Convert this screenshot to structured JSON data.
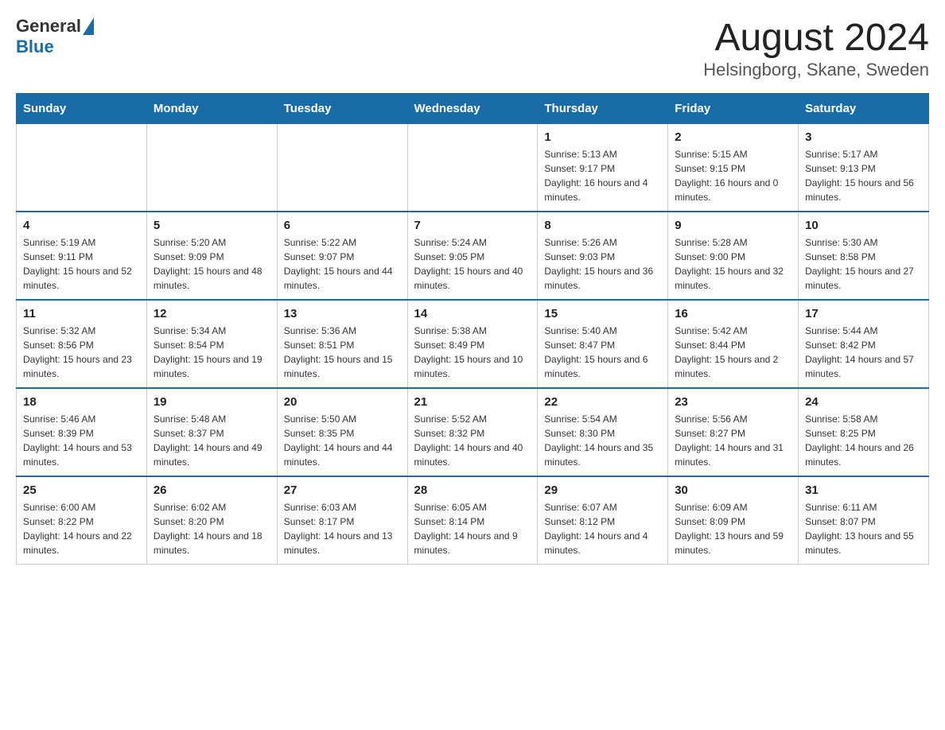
{
  "header": {
    "logo_general": "General",
    "logo_blue": "Blue",
    "month_year": "August 2024",
    "location": "Helsingborg, Skane, Sweden"
  },
  "days_of_week": [
    "Sunday",
    "Monday",
    "Tuesday",
    "Wednesday",
    "Thursday",
    "Friday",
    "Saturday"
  ],
  "weeks": [
    [
      {
        "num": "",
        "info": ""
      },
      {
        "num": "",
        "info": ""
      },
      {
        "num": "",
        "info": ""
      },
      {
        "num": "",
        "info": ""
      },
      {
        "num": "1",
        "info": "Sunrise: 5:13 AM\nSunset: 9:17 PM\nDaylight: 16 hours and 4 minutes."
      },
      {
        "num": "2",
        "info": "Sunrise: 5:15 AM\nSunset: 9:15 PM\nDaylight: 16 hours and 0 minutes."
      },
      {
        "num": "3",
        "info": "Sunrise: 5:17 AM\nSunset: 9:13 PM\nDaylight: 15 hours and 56 minutes."
      }
    ],
    [
      {
        "num": "4",
        "info": "Sunrise: 5:19 AM\nSunset: 9:11 PM\nDaylight: 15 hours and 52 minutes."
      },
      {
        "num": "5",
        "info": "Sunrise: 5:20 AM\nSunset: 9:09 PM\nDaylight: 15 hours and 48 minutes."
      },
      {
        "num": "6",
        "info": "Sunrise: 5:22 AM\nSunset: 9:07 PM\nDaylight: 15 hours and 44 minutes."
      },
      {
        "num": "7",
        "info": "Sunrise: 5:24 AM\nSunset: 9:05 PM\nDaylight: 15 hours and 40 minutes."
      },
      {
        "num": "8",
        "info": "Sunrise: 5:26 AM\nSunset: 9:03 PM\nDaylight: 15 hours and 36 minutes."
      },
      {
        "num": "9",
        "info": "Sunrise: 5:28 AM\nSunset: 9:00 PM\nDaylight: 15 hours and 32 minutes."
      },
      {
        "num": "10",
        "info": "Sunrise: 5:30 AM\nSunset: 8:58 PM\nDaylight: 15 hours and 27 minutes."
      }
    ],
    [
      {
        "num": "11",
        "info": "Sunrise: 5:32 AM\nSunset: 8:56 PM\nDaylight: 15 hours and 23 minutes."
      },
      {
        "num": "12",
        "info": "Sunrise: 5:34 AM\nSunset: 8:54 PM\nDaylight: 15 hours and 19 minutes."
      },
      {
        "num": "13",
        "info": "Sunrise: 5:36 AM\nSunset: 8:51 PM\nDaylight: 15 hours and 15 minutes."
      },
      {
        "num": "14",
        "info": "Sunrise: 5:38 AM\nSunset: 8:49 PM\nDaylight: 15 hours and 10 minutes."
      },
      {
        "num": "15",
        "info": "Sunrise: 5:40 AM\nSunset: 8:47 PM\nDaylight: 15 hours and 6 minutes."
      },
      {
        "num": "16",
        "info": "Sunrise: 5:42 AM\nSunset: 8:44 PM\nDaylight: 15 hours and 2 minutes."
      },
      {
        "num": "17",
        "info": "Sunrise: 5:44 AM\nSunset: 8:42 PM\nDaylight: 14 hours and 57 minutes."
      }
    ],
    [
      {
        "num": "18",
        "info": "Sunrise: 5:46 AM\nSunset: 8:39 PM\nDaylight: 14 hours and 53 minutes."
      },
      {
        "num": "19",
        "info": "Sunrise: 5:48 AM\nSunset: 8:37 PM\nDaylight: 14 hours and 49 minutes."
      },
      {
        "num": "20",
        "info": "Sunrise: 5:50 AM\nSunset: 8:35 PM\nDaylight: 14 hours and 44 minutes."
      },
      {
        "num": "21",
        "info": "Sunrise: 5:52 AM\nSunset: 8:32 PM\nDaylight: 14 hours and 40 minutes."
      },
      {
        "num": "22",
        "info": "Sunrise: 5:54 AM\nSunset: 8:30 PM\nDaylight: 14 hours and 35 minutes."
      },
      {
        "num": "23",
        "info": "Sunrise: 5:56 AM\nSunset: 8:27 PM\nDaylight: 14 hours and 31 minutes."
      },
      {
        "num": "24",
        "info": "Sunrise: 5:58 AM\nSunset: 8:25 PM\nDaylight: 14 hours and 26 minutes."
      }
    ],
    [
      {
        "num": "25",
        "info": "Sunrise: 6:00 AM\nSunset: 8:22 PM\nDaylight: 14 hours and 22 minutes."
      },
      {
        "num": "26",
        "info": "Sunrise: 6:02 AM\nSunset: 8:20 PM\nDaylight: 14 hours and 18 minutes."
      },
      {
        "num": "27",
        "info": "Sunrise: 6:03 AM\nSunset: 8:17 PM\nDaylight: 14 hours and 13 minutes."
      },
      {
        "num": "28",
        "info": "Sunrise: 6:05 AM\nSunset: 8:14 PM\nDaylight: 14 hours and 9 minutes."
      },
      {
        "num": "29",
        "info": "Sunrise: 6:07 AM\nSunset: 8:12 PM\nDaylight: 14 hours and 4 minutes."
      },
      {
        "num": "30",
        "info": "Sunrise: 6:09 AM\nSunset: 8:09 PM\nDaylight: 13 hours and 59 minutes."
      },
      {
        "num": "31",
        "info": "Sunrise: 6:11 AM\nSunset: 8:07 PM\nDaylight: 13 hours and 55 minutes."
      }
    ]
  ]
}
